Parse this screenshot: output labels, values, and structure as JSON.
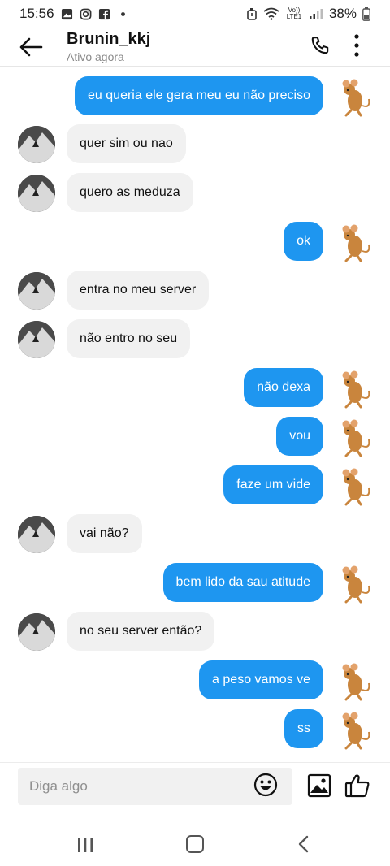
{
  "status_bar": {
    "time": "15:56",
    "volte": "Vo)) LTE1",
    "battery": "38%"
  },
  "header": {
    "name": "Brunin_kkj",
    "status": "Ativo agora"
  },
  "messages": [
    {
      "dir": "out",
      "text": "eu queria ele gera meu eu não preciso"
    },
    {
      "dir": "in",
      "text": "quer sim ou nao"
    },
    {
      "dir": "in",
      "text": "quero as meduza"
    },
    {
      "dir": "out",
      "text": "ok"
    },
    {
      "dir": "in",
      "text": "entra no meu server"
    },
    {
      "dir": "in",
      "text": "não entro no seu"
    },
    {
      "dir": "out",
      "text": "não dexa"
    },
    {
      "dir": "out",
      "text": "vou"
    },
    {
      "dir": "out",
      "text": "faze um vide"
    },
    {
      "dir": "in",
      "text": "vai não?"
    },
    {
      "dir": "out",
      "text": "bem lido da sau atitude"
    },
    {
      "dir": "in",
      "text": "no seu server então?"
    },
    {
      "dir": "out",
      "text": "a peso vamos ve"
    },
    {
      "dir": "out",
      "text": "ss"
    }
  ],
  "composer": {
    "placeholder": "Diga algo"
  },
  "icons": {
    "back": "arrow-left-icon",
    "call": "phone-icon",
    "more": "more-vertical-icon",
    "emoji": "emoji-icon",
    "gallery": "image-icon",
    "like": "thumbs-up-icon"
  },
  "colors": {
    "outgoing_bubble": "#1e96f0",
    "incoming_bubble": "#f1f1f1"
  }
}
